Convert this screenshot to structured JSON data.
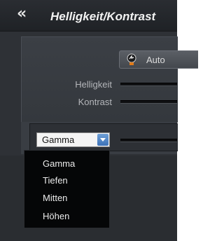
{
  "header": {
    "collapse_glyph": "«",
    "title": "Helligkeit/Kontrast"
  },
  "auto_button": {
    "label": "Auto",
    "icon": "auto-wand-icon"
  },
  "sliders": {
    "brightness_label": "Helligkeit",
    "contrast_label": "Kontrast"
  },
  "gamma_select": {
    "value": "Gamma",
    "options": [
      "Gamma",
      "Tiefen",
      "Mitten",
      "Höhen"
    ]
  },
  "colors": {
    "background": "#2e3136",
    "accent": "#3d72b8",
    "dropdown_bg": "#050607"
  }
}
